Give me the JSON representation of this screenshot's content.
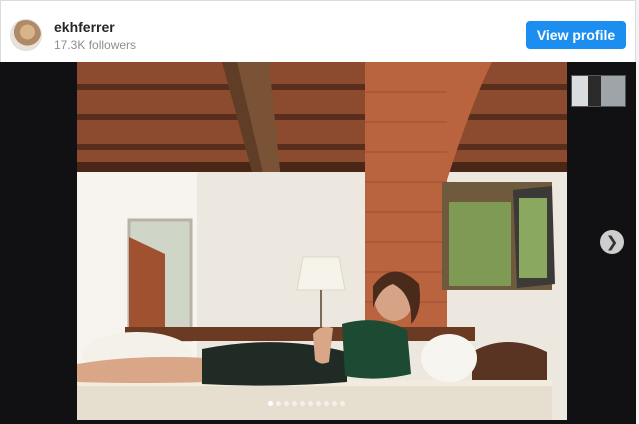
{
  "profile": {
    "username": "ekhferrer",
    "followers": "17.3K followers",
    "view_button": "View profile"
  },
  "carousel": {
    "slide_count": 10,
    "active_index": 0
  },
  "icons": {
    "next": "chevron-right-icon"
  }
}
